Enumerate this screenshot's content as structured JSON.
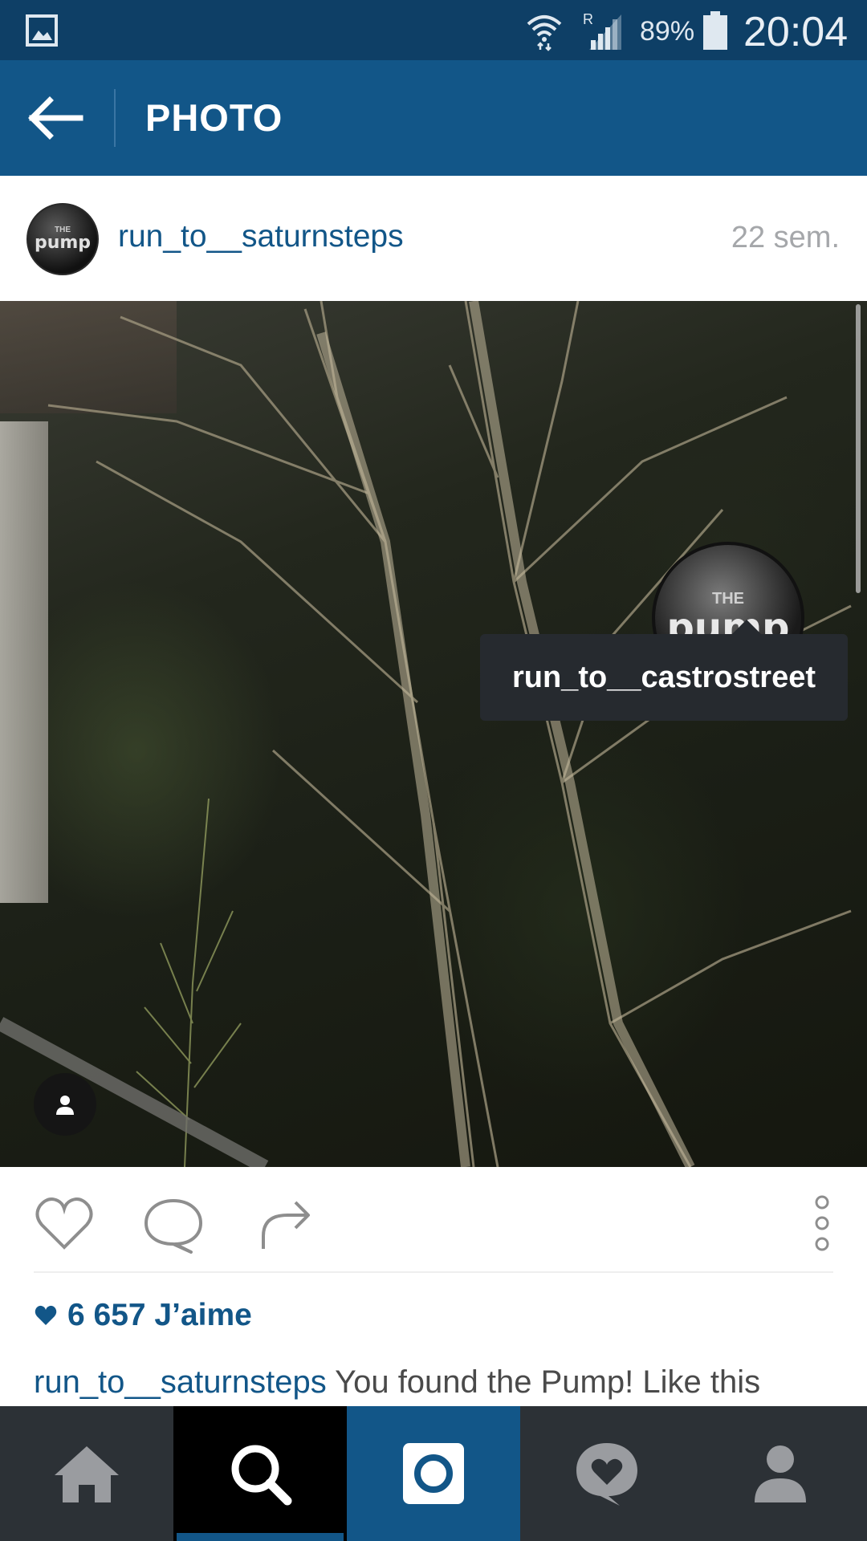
{
  "status_bar": {
    "battery_percent": "89%",
    "time": "20:04",
    "network_label": "R"
  },
  "app_bar": {
    "title": "PHOTO",
    "back_icon": "arrow-left-icon"
  },
  "post": {
    "username": "run_to__saturnsteps",
    "time_ago": "22 sem.",
    "avatar_logo_top": "THE",
    "avatar_logo_main": "pump",
    "photo": {
      "tag_username": "run_to__castrostreet",
      "tag_logo_top": "THE",
      "tag_logo_main": "pump"
    },
    "likes": "6 657 J’aime",
    "caption_user": "run_to__saturnsteps",
    "caption_text": "You found the Pump! Like this"
  },
  "actions": {
    "icons": [
      "heart-outline-icon",
      "comment-bubble-icon",
      "share-arrow-icon",
      "more-vertical-icon"
    ]
  },
  "bottom_nav": {
    "items": [
      "home-icon",
      "search-icon",
      "camera-icon",
      "activity-heart-icon",
      "profile-icon"
    ],
    "active": "search-icon"
  },
  "colors": {
    "status_bar": "#0e3f66",
    "app_bar": "#125688",
    "link_blue": "#125688",
    "nav_bg": "#2c3136"
  }
}
